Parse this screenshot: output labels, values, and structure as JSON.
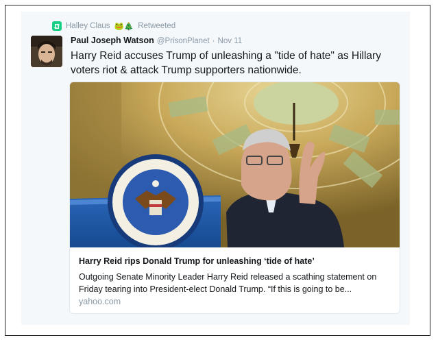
{
  "retweet": {
    "icon": "retweet-icon",
    "user": "Halley Claus",
    "emoji": "🐸🎄",
    "label": "Retweeted",
    "accent": "#19cf86"
  },
  "tweet": {
    "author_name": "Paul Joseph Watson",
    "author_handle": "@PrisonPlanet",
    "separator": "·",
    "date": "Nov 11",
    "text": "Harry Reid accuses Trump of unleashing a \"tide of hate\" as Hillary voters riot & attack Trump supporters nationwide."
  },
  "link_card": {
    "title": "Harry Reid rips Donald Trump for unleashing ‘tide of hate’",
    "description": "Outgoing Senate Minority Leader Harry Reid released a scathing statement on Friday tearing into President-elect Donald Trump. “If this is going to be...",
    "domain": "yahoo.com"
  },
  "colors": {
    "text": "#14171a",
    "muted": "#8899a6",
    "card_bg": "#f5f8fa",
    "border": "#e1e8ed"
  }
}
